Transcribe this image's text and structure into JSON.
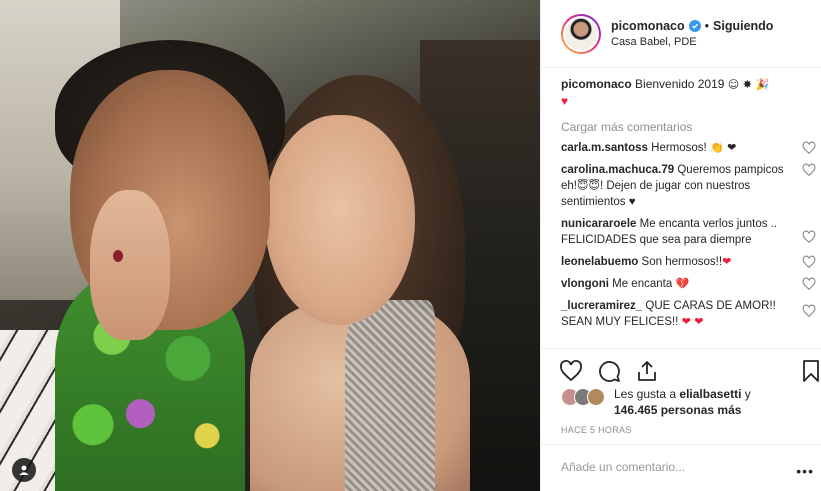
{
  "header": {
    "username": "picomonaco",
    "separator": "•",
    "follow_status": "Siguiendo",
    "location": "Casa Babel, PDE"
  },
  "caption": {
    "username": "picomonaco",
    "text": "Bienvenido 2019",
    "emojis": "☺ ✸ 🎉",
    "heart": "♥"
  },
  "load_more": "Cargar más comentarios",
  "comments": [
    {
      "user": "carla.m.santoss",
      "text": "Hermosos!",
      "emoji": "👏 ❤"
    },
    {
      "user": "carolina.machuca.79",
      "text": "Queremos pampicos eh!",
      "emoji": "😇😇",
      "text2": "! Dejen de jugar con nuestros sentimientos ♥"
    },
    {
      "user": "nunicararoele",
      "text": "Me encanta verlos juntos .. FELICIDADES que sea para diempre"
    },
    {
      "user": "leonelabuemo",
      "text": "Son hermosos!!",
      "emoji": "❤"
    },
    {
      "user": "vlongoni",
      "text": "Me encanta",
      "emoji": "💔"
    },
    {
      "user": "_lucreramirez_",
      "text": "QUE CARAS DE AMOR!! SEAN MUY FELICES!!",
      "emoji": "❤ ❤"
    }
  ],
  "likes": {
    "line1_prefix": "Les gusta a",
    "liked_by": "elialbasetti",
    "line1_suffix": "y",
    "count": "146.465 personas más"
  },
  "timestamp": "HACE 5 HORAS",
  "comment_input": {
    "placeholder": "Añade un comentario..."
  },
  "more_label": "•••",
  "colors": {
    "verified": "#3897f0",
    "muted": "#8e8e8e",
    "heart_red": "#ed1f3a"
  }
}
